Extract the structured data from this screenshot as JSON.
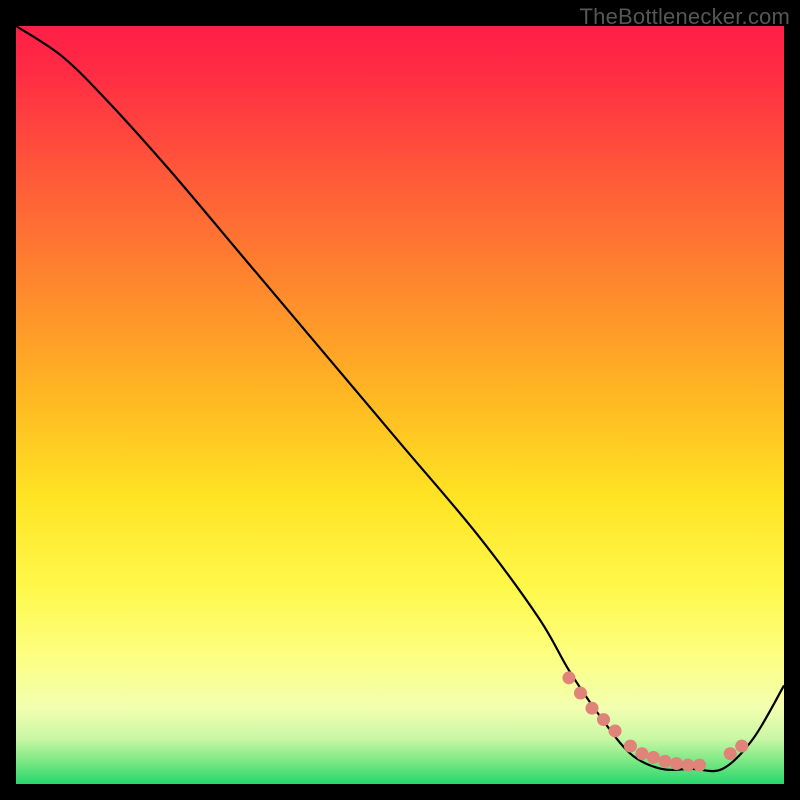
{
  "attribution": "TheBottlenecker.com",
  "chart_data": {
    "type": "line",
    "title": "",
    "xlabel": "",
    "ylabel": "",
    "xlim": [
      0,
      100
    ],
    "ylim": [
      0,
      100
    ],
    "series": [
      {
        "name": "bottleneck-curve",
        "x": [
          0,
          6,
          12,
          20,
          30,
          40,
          50,
          60,
          68,
          72,
          76,
          80,
          84,
          88,
          92,
          96,
          100
        ],
        "y": [
          100,
          96,
          90,
          81,
          69,
          57,
          45,
          33,
          22,
          15,
          9,
          4,
          2,
          2,
          2,
          6,
          13
        ]
      }
    ],
    "markers": {
      "name": "sweet-spot-points",
      "x": [
        72,
        73.5,
        75,
        76.5,
        78,
        80,
        81.5,
        83,
        84.5,
        86,
        87.5,
        89,
        93,
        94.5
      ],
      "y": [
        14,
        12,
        10,
        8.5,
        7,
        5,
        4,
        3.5,
        3,
        2.7,
        2.5,
        2.5,
        4,
        5
      ]
    },
    "gradient_stops": [
      {
        "offset": 0.0,
        "color": "#ff1f47"
      },
      {
        "offset": 0.06,
        "color": "#ff2b44"
      },
      {
        "offset": 0.2,
        "color": "#ff5a39"
      },
      {
        "offset": 0.35,
        "color": "#ff8a2d"
      },
      {
        "offset": 0.5,
        "color": "#ffbb22"
      },
      {
        "offset": 0.62,
        "color": "#ffe324"
      },
      {
        "offset": 0.74,
        "color": "#fff84a"
      },
      {
        "offset": 0.83,
        "color": "#fdff80"
      },
      {
        "offset": 0.9,
        "color": "#f2ffb0"
      },
      {
        "offset": 0.94,
        "color": "#caf7a4"
      },
      {
        "offset": 0.97,
        "color": "#7be884"
      },
      {
        "offset": 1.0,
        "color": "#26d66e"
      }
    ]
  }
}
